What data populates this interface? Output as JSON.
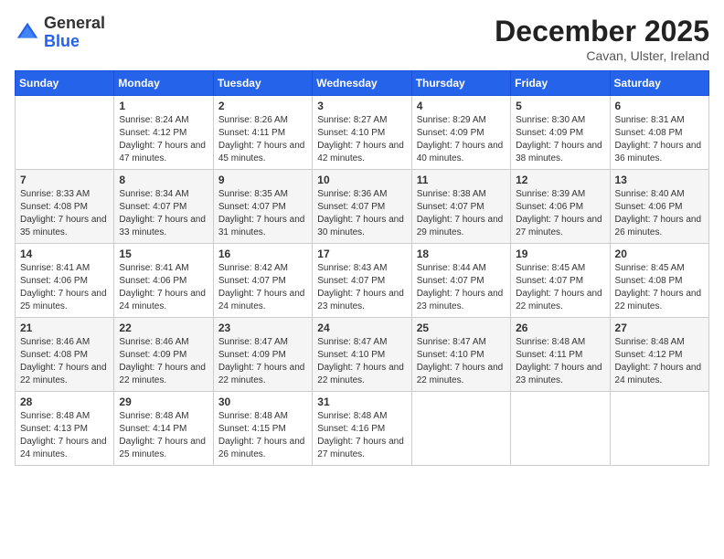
{
  "logo": {
    "general": "General",
    "blue": "Blue"
  },
  "header": {
    "month": "December 2025",
    "location": "Cavan, Ulster, Ireland"
  },
  "weekdays": [
    "Sunday",
    "Monday",
    "Tuesday",
    "Wednesday",
    "Thursday",
    "Friday",
    "Saturday"
  ],
  "weeks": [
    [
      {
        "day": "",
        "sunrise": "",
        "sunset": "",
        "daylight": ""
      },
      {
        "day": "1",
        "sunrise": "Sunrise: 8:24 AM",
        "sunset": "Sunset: 4:12 PM",
        "daylight": "Daylight: 7 hours and 47 minutes."
      },
      {
        "day": "2",
        "sunrise": "Sunrise: 8:26 AM",
        "sunset": "Sunset: 4:11 PM",
        "daylight": "Daylight: 7 hours and 45 minutes."
      },
      {
        "day": "3",
        "sunrise": "Sunrise: 8:27 AM",
        "sunset": "Sunset: 4:10 PM",
        "daylight": "Daylight: 7 hours and 42 minutes."
      },
      {
        "day": "4",
        "sunrise": "Sunrise: 8:29 AM",
        "sunset": "Sunset: 4:09 PM",
        "daylight": "Daylight: 7 hours and 40 minutes."
      },
      {
        "day": "5",
        "sunrise": "Sunrise: 8:30 AM",
        "sunset": "Sunset: 4:09 PM",
        "daylight": "Daylight: 7 hours and 38 minutes."
      },
      {
        "day": "6",
        "sunrise": "Sunrise: 8:31 AM",
        "sunset": "Sunset: 4:08 PM",
        "daylight": "Daylight: 7 hours and 36 minutes."
      }
    ],
    [
      {
        "day": "7",
        "sunrise": "Sunrise: 8:33 AM",
        "sunset": "Sunset: 4:08 PM",
        "daylight": "Daylight: 7 hours and 35 minutes."
      },
      {
        "day": "8",
        "sunrise": "Sunrise: 8:34 AM",
        "sunset": "Sunset: 4:07 PM",
        "daylight": "Daylight: 7 hours and 33 minutes."
      },
      {
        "day": "9",
        "sunrise": "Sunrise: 8:35 AM",
        "sunset": "Sunset: 4:07 PM",
        "daylight": "Daylight: 7 hours and 31 minutes."
      },
      {
        "day": "10",
        "sunrise": "Sunrise: 8:36 AM",
        "sunset": "Sunset: 4:07 PM",
        "daylight": "Daylight: 7 hours and 30 minutes."
      },
      {
        "day": "11",
        "sunrise": "Sunrise: 8:38 AM",
        "sunset": "Sunset: 4:07 PM",
        "daylight": "Daylight: 7 hours and 29 minutes."
      },
      {
        "day": "12",
        "sunrise": "Sunrise: 8:39 AM",
        "sunset": "Sunset: 4:06 PM",
        "daylight": "Daylight: 7 hours and 27 minutes."
      },
      {
        "day": "13",
        "sunrise": "Sunrise: 8:40 AM",
        "sunset": "Sunset: 4:06 PM",
        "daylight": "Daylight: 7 hours and 26 minutes."
      }
    ],
    [
      {
        "day": "14",
        "sunrise": "Sunrise: 8:41 AM",
        "sunset": "Sunset: 4:06 PM",
        "daylight": "Daylight: 7 hours and 25 minutes."
      },
      {
        "day": "15",
        "sunrise": "Sunrise: 8:41 AM",
        "sunset": "Sunset: 4:06 PM",
        "daylight": "Daylight: 7 hours and 24 minutes."
      },
      {
        "day": "16",
        "sunrise": "Sunrise: 8:42 AM",
        "sunset": "Sunset: 4:07 PM",
        "daylight": "Daylight: 7 hours and 24 minutes."
      },
      {
        "day": "17",
        "sunrise": "Sunrise: 8:43 AM",
        "sunset": "Sunset: 4:07 PM",
        "daylight": "Daylight: 7 hours and 23 minutes."
      },
      {
        "day": "18",
        "sunrise": "Sunrise: 8:44 AM",
        "sunset": "Sunset: 4:07 PM",
        "daylight": "Daylight: 7 hours and 23 minutes."
      },
      {
        "day": "19",
        "sunrise": "Sunrise: 8:45 AM",
        "sunset": "Sunset: 4:07 PM",
        "daylight": "Daylight: 7 hours and 22 minutes."
      },
      {
        "day": "20",
        "sunrise": "Sunrise: 8:45 AM",
        "sunset": "Sunset: 4:08 PM",
        "daylight": "Daylight: 7 hours and 22 minutes."
      }
    ],
    [
      {
        "day": "21",
        "sunrise": "Sunrise: 8:46 AM",
        "sunset": "Sunset: 4:08 PM",
        "daylight": "Daylight: 7 hours and 22 minutes."
      },
      {
        "day": "22",
        "sunrise": "Sunrise: 8:46 AM",
        "sunset": "Sunset: 4:09 PM",
        "daylight": "Daylight: 7 hours and 22 minutes."
      },
      {
        "day": "23",
        "sunrise": "Sunrise: 8:47 AM",
        "sunset": "Sunset: 4:09 PM",
        "daylight": "Daylight: 7 hours and 22 minutes."
      },
      {
        "day": "24",
        "sunrise": "Sunrise: 8:47 AM",
        "sunset": "Sunset: 4:10 PM",
        "daylight": "Daylight: 7 hours and 22 minutes."
      },
      {
        "day": "25",
        "sunrise": "Sunrise: 8:47 AM",
        "sunset": "Sunset: 4:10 PM",
        "daylight": "Daylight: 7 hours and 22 minutes."
      },
      {
        "day": "26",
        "sunrise": "Sunrise: 8:48 AM",
        "sunset": "Sunset: 4:11 PM",
        "daylight": "Daylight: 7 hours and 23 minutes."
      },
      {
        "day": "27",
        "sunrise": "Sunrise: 8:48 AM",
        "sunset": "Sunset: 4:12 PM",
        "daylight": "Daylight: 7 hours and 24 minutes."
      }
    ],
    [
      {
        "day": "28",
        "sunrise": "Sunrise: 8:48 AM",
        "sunset": "Sunset: 4:13 PM",
        "daylight": "Daylight: 7 hours and 24 minutes."
      },
      {
        "day": "29",
        "sunrise": "Sunrise: 8:48 AM",
        "sunset": "Sunset: 4:14 PM",
        "daylight": "Daylight: 7 hours and 25 minutes."
      },
      {
        "day": "30",
        "sunrise": "Sunrise: 8:48 AM",
        "sunset": "Sunset: 4:15 PM",
        "daylight": "Daylight: 7 hours and 26 minutes."
      },
      {
        "day": "31",
        "sunrise": "Sunrise: 8:48 AM",
        "sunset": "Sunset: 4:16 PM",
        "daylight": "Daylight: 7 hours and 27 minutes."
      },
      {
        "day": "",
        "sunrise": "",
        "sunset": "",
        "daylight": ""
      },
      {
        "day": "",
        "sunrise": "",
        "sunset": "",
        "daylight": ""
      },
      {
        "day": "",
        "sunrise": "",
        "sunset": "",
        "daylight": ""
      }
    ]
  ]
}
